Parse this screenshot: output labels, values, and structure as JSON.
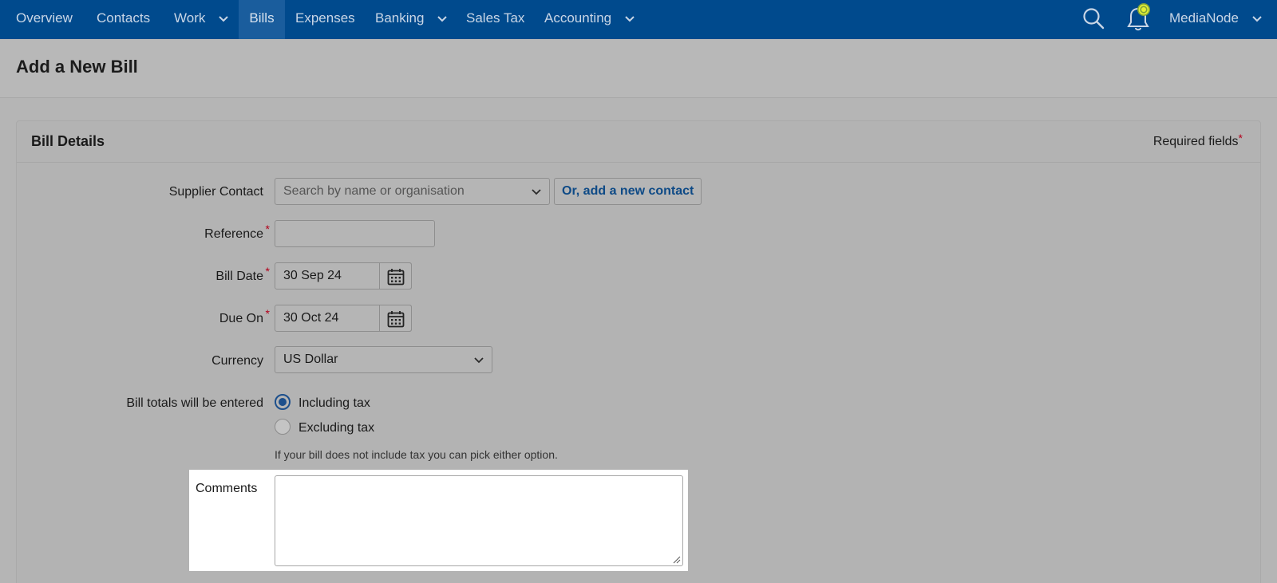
{
  "nav": {
    "items": [
      {
        "label": "Overview"
      },
      {
        "label": "Contacts"
      },
      {
        "label": "Work"
      },
      {
        "label": "Bills"
      },
      {
        "label": "Expenses"
      },
      {
        "label": "Banking"
      },
      {
        "label": "Sales Tax"
      },
      {
        "label": "Accounting"
      }
    ],
    "active": "Bills",
    "account": "MediaNode",
    "icons": [
      "search-icon",
      "notification-bell-icon",
      "chevron-down-icon"
    ]
  },
  "page": {
    "title": "Add a New Bill"
  },
  "card": {
    "title": "Bill Details",
    "required_note": "Required fields",
    "required_star": "*"
  },
  "form": {
    "supplier": {
      "label": "Supplier Contact",
      "placeholder": "Search by name or organisation",
      "add_button": "Or, add a new contact"
    },
    "reference": {
      "label": "Reference",
      "value": ""
    },
    "bill_date": {
      "label": "Bill Date",
      "value": "30 Sep 24"
    },
    "due_on": {
      "label": "Due On",
      "value": "30 Oct 24"
    },
    "currency": {
      "label": "Currency",
      "value": "US Dollar"
    },
    "totals": {
      "label": "Bill totals will be entered",
      "options": [
        "Including tax",
        "Excluding tax"
      ],
      "selected": "Including tax",
      "hint": "If your bill does not include tax you can pick either option."
    },
    "comments": {
      "label": "Comments",
      "value": ""
    }
  },
  "colors": {
    "nav_bg": "#004a8d",
    "accent": "#0e4a86",
    "required": "#b3001b",
    "highlight": "#ffffff"
  }
}
